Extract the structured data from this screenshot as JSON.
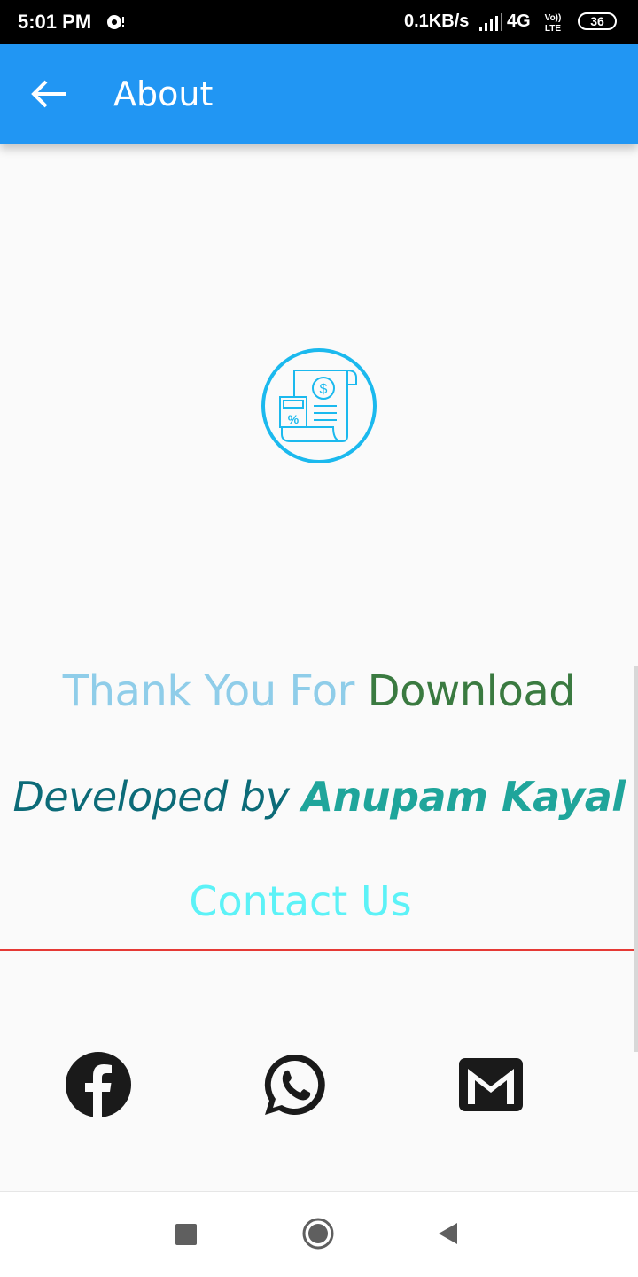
{
  "status_bar": {
    "time": "5:01 PM",
    "network_speed": "0.1KB/s",
    "network_type": "4G",
    "volte_label": "Vo LTE",
    "battery": "36",
    "notification_icon": "hotspot-icon"
  },
  "app_bar": {
    "title": "About",
    "back_icon": "arrow-left-icon",
    "background_color": "#2196f3"
  },
  "logo": {
    "icon": "invoice-tax-calculator-icon",
    "color": "#1bb9ee"
  },
  "thanks": {
    "part1": "Thank You For",
    "part2": "Download"
  },
  "developer": {
    "prefix": "Developed by",
    "name": "Anupam Kayal"
  },
  "contact": {
    "label": "Contact Us"
  },
  "social_links": [
    {
      "name": "facebook",
      "icon": "facebook-icon"
    },
    {
      "name": "whatsapp",
      "icon": "whatsapp-icon"
    },
    {
      "name": "gmail",
      "icon": "gmail-icon"
    }
  ],
  "nav_bar": {
    "recents_icon": "square-icon",
    "home_icon": "circle-icon",
    "back_icon": "triangle-back-icon"
  },
  "colors": {
    "divider": "#e53935",
    "contact": "#5cf2f7",
    "thanks_light": "#8fcde9",
    "thanks_dark": "#3a7a40",
    "developed_prefix": "#0c6b78",
    "developer_name": "#1fa59b"
  }
}
